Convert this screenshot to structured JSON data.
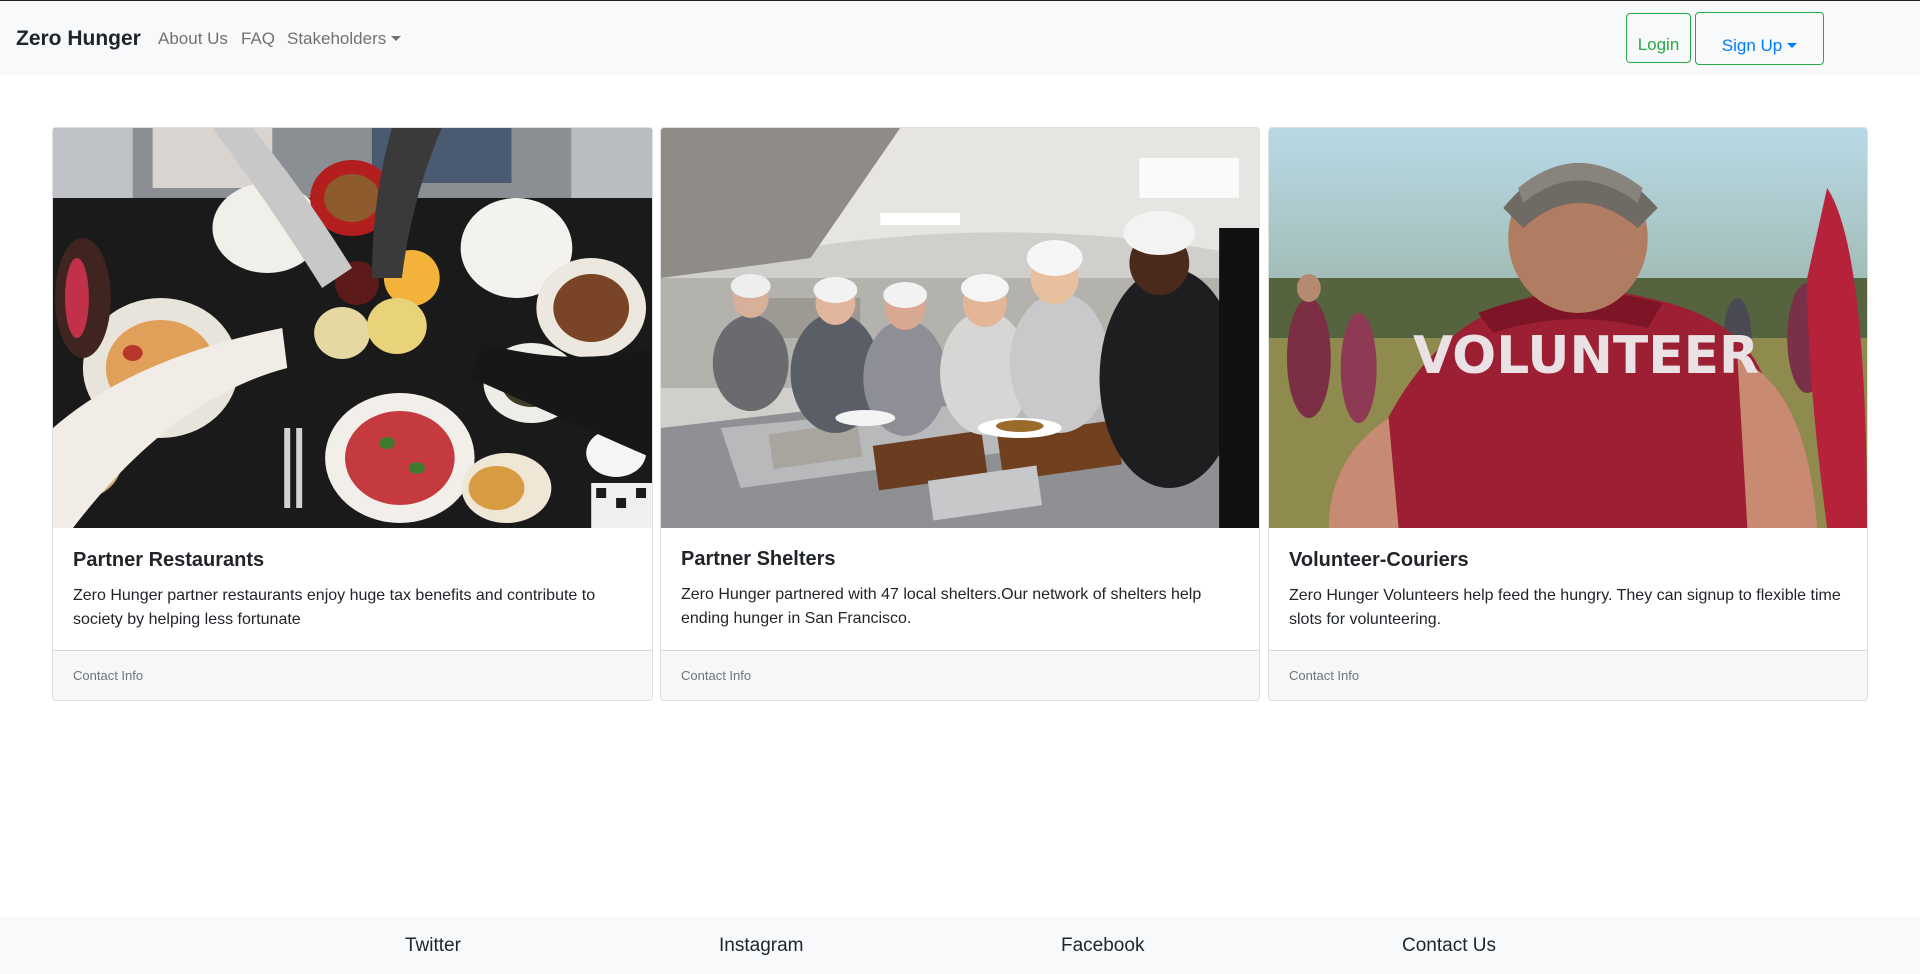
{
  "navbar": {
    "brand": "Zero Hunger",
    "links": {
      "about": "About Us",
      "faq": "FAQ",
      "stakeholders": "Stakeholders"
    },
    "login_label": "Login",
    "signup_label": "Sign Up"
  },
  "cards": [
    {
      "title": "Partner Restaurants",
      "text": "Zero Hunger partner restaurants enjoy huge tax benefits and contribute to society by helping less fortunate",
      "footer": "Contact Info",
      "image": "restaurant-table-photo"
    },
    {
      "title": "Partner Shelters",
      "text": "Zero Hunger partnered with 47 local shelters.Our network of shelters help ending hunger in San Francisco.",
      "footer": "Contact Info",
      "image": "shelter-kitchen-photo"
    },
    {
      "title": "Volunteer-Couriers",
      "text": "Zero Hunger Volunteers help feed the hungry. They can signup to flexible time slots for volunteering.",
      "footer": "Contact Info",
      "image": "volunteer-shirt-photo",
      "image_text": "VOLUNTEER"
    }
  ],
  "footer": {
    "twitter": "Twitter",
    "instagram": "Instagram",
    "facebook": "Facebook",
    "contact": "Contact Us"
  },
  "colors": {
    "navbar_bg": "#f8f9fa",
    "success": "#28a745",
    "primary": "#007bff",
    "muted": "#6c757d"
  }
}
